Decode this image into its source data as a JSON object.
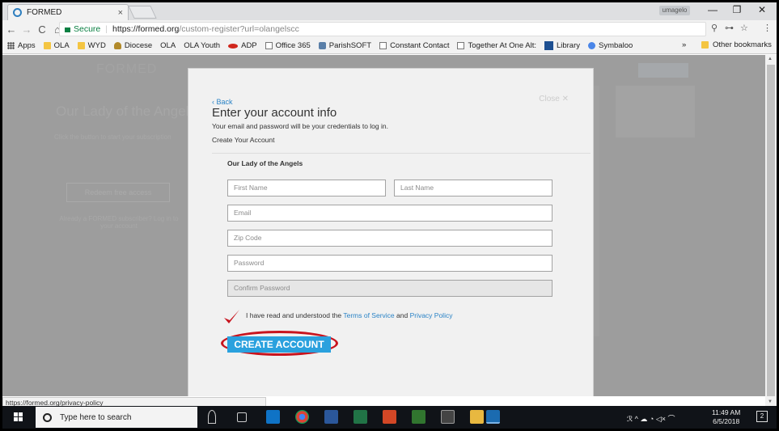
{
  "browser": {
    "tab_title": "FORMED",
    "tab_close": "×",
    "profile": "umagelo",
    "win_min": "—",
    "win_max": "❐",
    "win_close": "✕",
    "nav_back": "←",
    "nav_forward": "→",
    "nav_reload": "C",
    "nav_home": "⌂",
    "secure_label": "Secure",
    "url_domain": "https://formed.org",
    "url_path": "/custom-register?url=olangelscc",
    "omni_icons": [
      "magnifier-icon",
      "key-icon",
      "star-icon"
    ],
    "omni_icon_glyphs": [
      "⚲",
      "⊶",
      "☆"
    ],
    "menu_glyph": "⋮"
  },
  "bookmarks": {
    "items": [
      {
        "label": "Apps",
        "icon": "apps-grid-icon"
      },
      {
        "label": "OLA",
        "icon": "folder-icon"
      },
      {
        "label": "WYD",
        "icon": "folder-icon"
      },
      {
        "label": "Diocese",
        "icon": "diocese-icon"
      },
      {
        "label": "OLA",
        "icon": "none"
      },
      {
        "label": "OLA Youth",
        "icon": "none"
      },
      {
        "label": "ADP",
        "icon": "adp-icon"
      },
      {
        "label": "Office 365",
        "icon": "page-icon"
      },
      {
        "label": "ParishSOFT",
        "icon": "parishsoft-icon"
      },
      {
        "label": "Constant Contact",
        "icon": "page-icon"
      },
      {
        "label": "Together At One Alt:",
        "icon": "page-icon"
      },
      {
        "label": "Library",
        "icon": "library-icon"
      },
      {
        "label": "Symbaloo",
        "icon": "symbaloo-icon"
      }
    ],
    "overflow": "»",
    "other_label": "Other bookmarks"
  },
  "background_page": {
    "logo": "FORMED",
    "title": "Our Lady of the Angels",
    "subtitle": "Click the button to start your subscription",
    "button_label": "Redeem free access",
    "note": "Already a FORMED subscriber? Log in to your account"
  },
  "modal": {
    "close_label": "Close ✕",
    "back_label": "‹ Back",
    "title": "Enter your account info",
    "description": "Your email and password will be your credentials to log in.",
    "create_heading": "Create Your Account",
    "parish": "Our Lady of the Angels",
    "fields": {
      "first_name": "First Name",
      "last_name": "Last Name",
      "email": "Email",
      "zip": "Zip Code",
      "password": "Password",
      "confirm_password": "Confirm Password"
    },
    "terms_prefix": "I have read and understood the ",
    "terms_link": "Terms of Service",
    "terms_mid": " and ",
    "privacy_link": "Privacy Policy",
    "cta_label": "CREATE ACCOUNT"
  },
  "status_bar": {
    "url": "https://formed.org/privacy-policy"
  },
  "taskbar": {
    "search_placeholder": "Type here to search",
    "time": "11:49 AM",
    "date": "6/5/2018",
    "tray": "ℛ  ^  ☁  ◔  ◁×  ⌒",
    "notifications": "2"
  },
  "colors": {
    "accent": "#2aa1de",
    "link": "#2a83c6",
    "annotation_red": "#c8141e",
    "overlay_gray": "#9d9d9d",
    "modal_bg": "#f1f1f1",
    "taskbar": "#101318"
  }
}
